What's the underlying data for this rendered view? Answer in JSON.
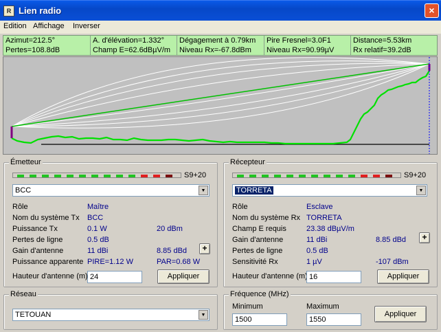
{
  "window": {
    "title": "Lien radio",
    "close": "×",
    "icon_text": "R"
  },
  "menu": [
    "Edition",
    "Affichage",
    "Inverser"
  ],
  "info": {
    "row1": [
      "Azimut=212.5°",
      "A. d'élévation=1.332°",
      "Dégagement à 0.79km",
      "Pire Fresnel=3.0F1",
      "Distance=5.53km"
    ],
    "row2": [
      "Pertes=108.8dB",
      "Champ E=62.6dBµV/m",
      "Niveau Rx=-67.8dBm",
      "Niveau Rx=90.99µV",
      "Rx relatif=39.2dB"
    ]
  },
  "colors": {
    "info_bg": "#b8f0a8",
    "terrain": "#00e000",
    "los": "#00c000",
    "fresnel": "#ffffff",
    "antenna": "#800080",
    "meter_green": "#22c422",
    "meter_red": "#e02020",
    "meter_dark": "#7a1010"
  },
  "profile": {
    "distance_km": 5.53,
    "tx_antenna_m": 24,
    "rx_antenna_m": 16
  },
  "emetteur": {
    "title": "Émetteur",
    "meter_label": "S9+20",
    "meter_segments": [
      "green",
      "green",
      "green",
      "green",
      "green",
      "green",
      "green",
      "green",
      "green",
      "green",
      "red",
      "red",
      "dark"
    ],
    "selected": "BCC",
    "rows": [
      {
        "label": "Rôle",
        "value": "Maître",
        "value2": ""
      },
      {
        "label": "Nom du système Tx",
        "value": "BCC",
        "value2": ""
      },
      {
        "label": "Puissance Tx",
        "value": "0.1 W",
        "value2": "20 dBm"
      },
      {
        "label": "Pertes de ligne",
        "value": "0.5 dB",
        "value2": ""
      },
      {
        "label": "Gain d'antenne",
        "value": "11 dBi",
        "value2": "8.85 dBd"
      },
      {
        "label": "Puissance apparente",
        "value": "PIRE=1.12 W",
        "value2": "PAR=0.68 W"
      }
    ],
    "height_label": "Hauteur d'antenne (m)",
    "height_value": "24",
    "apply": "Appliquer",
    "plus": "+"
  },
  "recepteur": {
    "title": "Récepteur",
    "meter_label": "S9+20",
    "meter_segments": [
      "green",
      "green",
      "green",
      "green",
      "green",
      "green",
      "green",
      "green",
      "green",
      "green",
      "red",
      "red",
      "dark"
    ],
    "selected": "TORRETA",
    "rows": [
      {
        "label": "Rôle",
        "value": "Esclave",
        "value2": ""
      },
      {
        "label": "Nom du système Rx",
        "value": "TORRETA",
        "value2": ""
      },
      {
        "label": "Champ E requis",
        "value": "23.38 dBµV/m",
        "value2": ""
      },
      {
        "label": "Gain d'antenne",
        "value": "11 dBi",
        "value2": "8.85 dBd"
      },
      {
        "label": "Pertes de ligne",
        "value": "0.5 dB",
        "value2": ""
      },
      {
        "label": "Sensitivité Rx",
        "value": "1 µV",
        "value2": "-107 dBm"
      }
    ],
    "height_label": "Hauteur d'antenne (m)",
    "height_value": "16",
    "apply": "Appliquer",
    "plus": "+"
  },
  "reseau": {
    "title": "Réseau",
    "selected": "TETOUAN"
  },
  "frequence": {
    "title": "Fréquence (MHz)",
    "min_label": "Minimum",
    "min_value": "1500",
    "max_label": "Maximum",
    "max_value": "1550",
    "apply": "Appliquer"
  }
}
